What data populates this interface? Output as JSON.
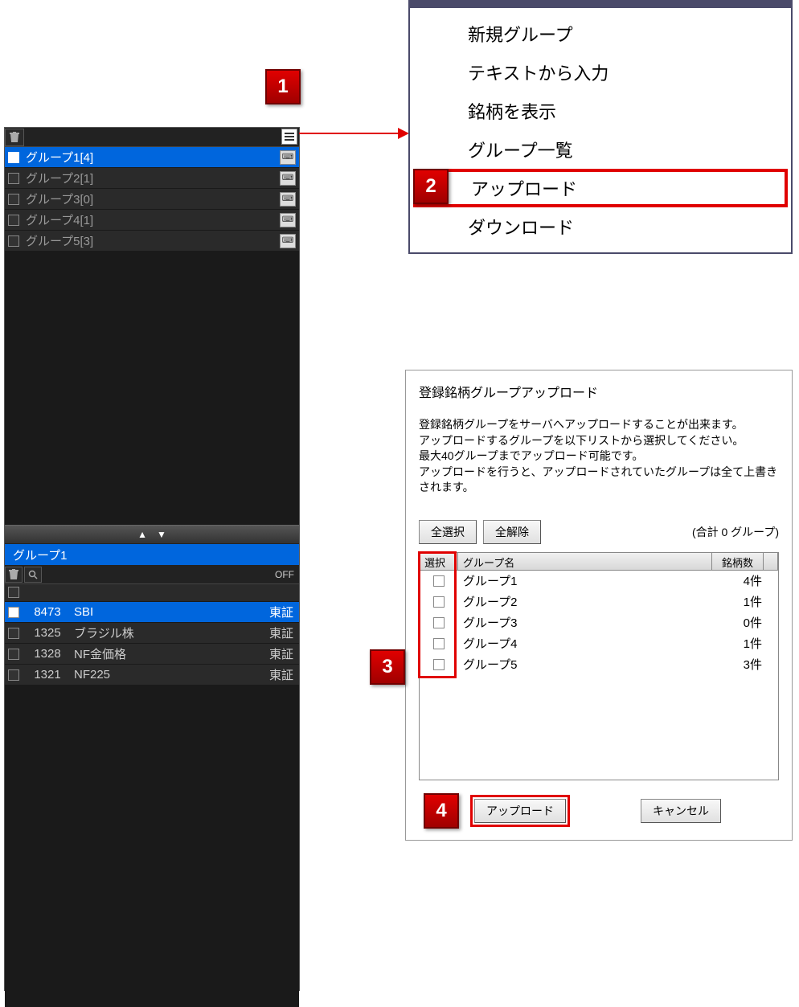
{
  "groupPanel": {
    "groups": [
      {
        "label": "グループ1[4]",
        "selected": true
      },
      {
        "label": "グループ2[1]",
        "selected": false
      },
      {
        "label": "グループ3[0]",
        "selected": false
      },
      {
        "label": "グループ4[1]",
        "selected": false
      },
      {
        "label": "グループ5[3]",
        "selected": false
      }
    ]
  },
  "stockPanel": {
    "title": "グループ1",
    "off": "OFF",
    "rows": [
      {
        "code": "8473",
        "name": "SBI",
        "market": "東証",
        "selected": true
      },
      {
        "code": "1325",
        "name": "ブラジル株",
        "market": "東証",
        "selected": false
      },
      {
        "code": "1328",
        "name": "NF金価格",
        "market": "東証",
        "selected": false
      },
      {
        "code": "1321",
        "name": "NF225",
        "market": "東証",
        "selected": false
      }
    ]
  },
  "contextMenu": {
    "items": [
      "新規グループ",
      "テキストから入力",
      "銘柄を表示",
      "グループ一覧",
      "アップロード",
      "ダウンロード"
    ]
  },
  "dialog": {
    "title": "登録銘柄グループアップロード",
    "text1": "登録銘柄グループをサーバへアップロードすることが出来ます。",
    "text2": "アップロードするグループを以下リストから選択してください。",
    "text3": "最大40グループまでアップロード可能です。",
    "text4": "アップロードを行うと、アップロードされていたグループは全て上書きされます。",
    "selectAll": "全選択",
    "deselectAll": "全解除",
    "countText": "(合計 0 グループ)",
    "headers": {
      "select": "選択",
      "name": "グループ名",
      "count": "銘柄数"
    },
    "rows": [
      {
        "name": "グループ1",
        "count": "4件"
      },
      {
        "name": "グループ2",
        "count": "1件"
      },
      {
        "name": "グループ3",
        "count": "0件"
      },
      {
        "name": "グループ4",
        "count": "1件"
      },
      {
        "name": "グループ5",
        "count": "3件"
      }
    ],
    "uploadBtn": "アップロード",
    "cancelBtn": "キャンセル"
  },
  "callouts": {
    "c1": "1",
    "c2": "2",
    "c3": "3",
    "c4": "4"
  }
}
